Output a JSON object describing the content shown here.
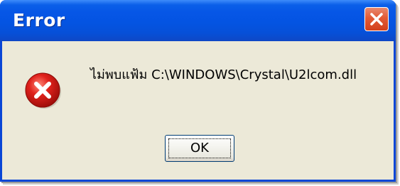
{
  "window": {
    "title": "Error"
  },
  "icons": {
    "close": "close-icon",
    "error": "error-icon"
  },
  "colors": {
    "titlebar": "#0454e2",
    "close_button": "#e25a35",
    "dialog_background": "#ece9d8",
    "error_icon": "#e0221c"
  },
  "message": {
    "text": "ไม่พบแฟ้ม C:\\WINDOWS\\Crystal\\U2lcom.dll"
  },
  "buttons": {
    "ok_label": "OK"
  }
}
